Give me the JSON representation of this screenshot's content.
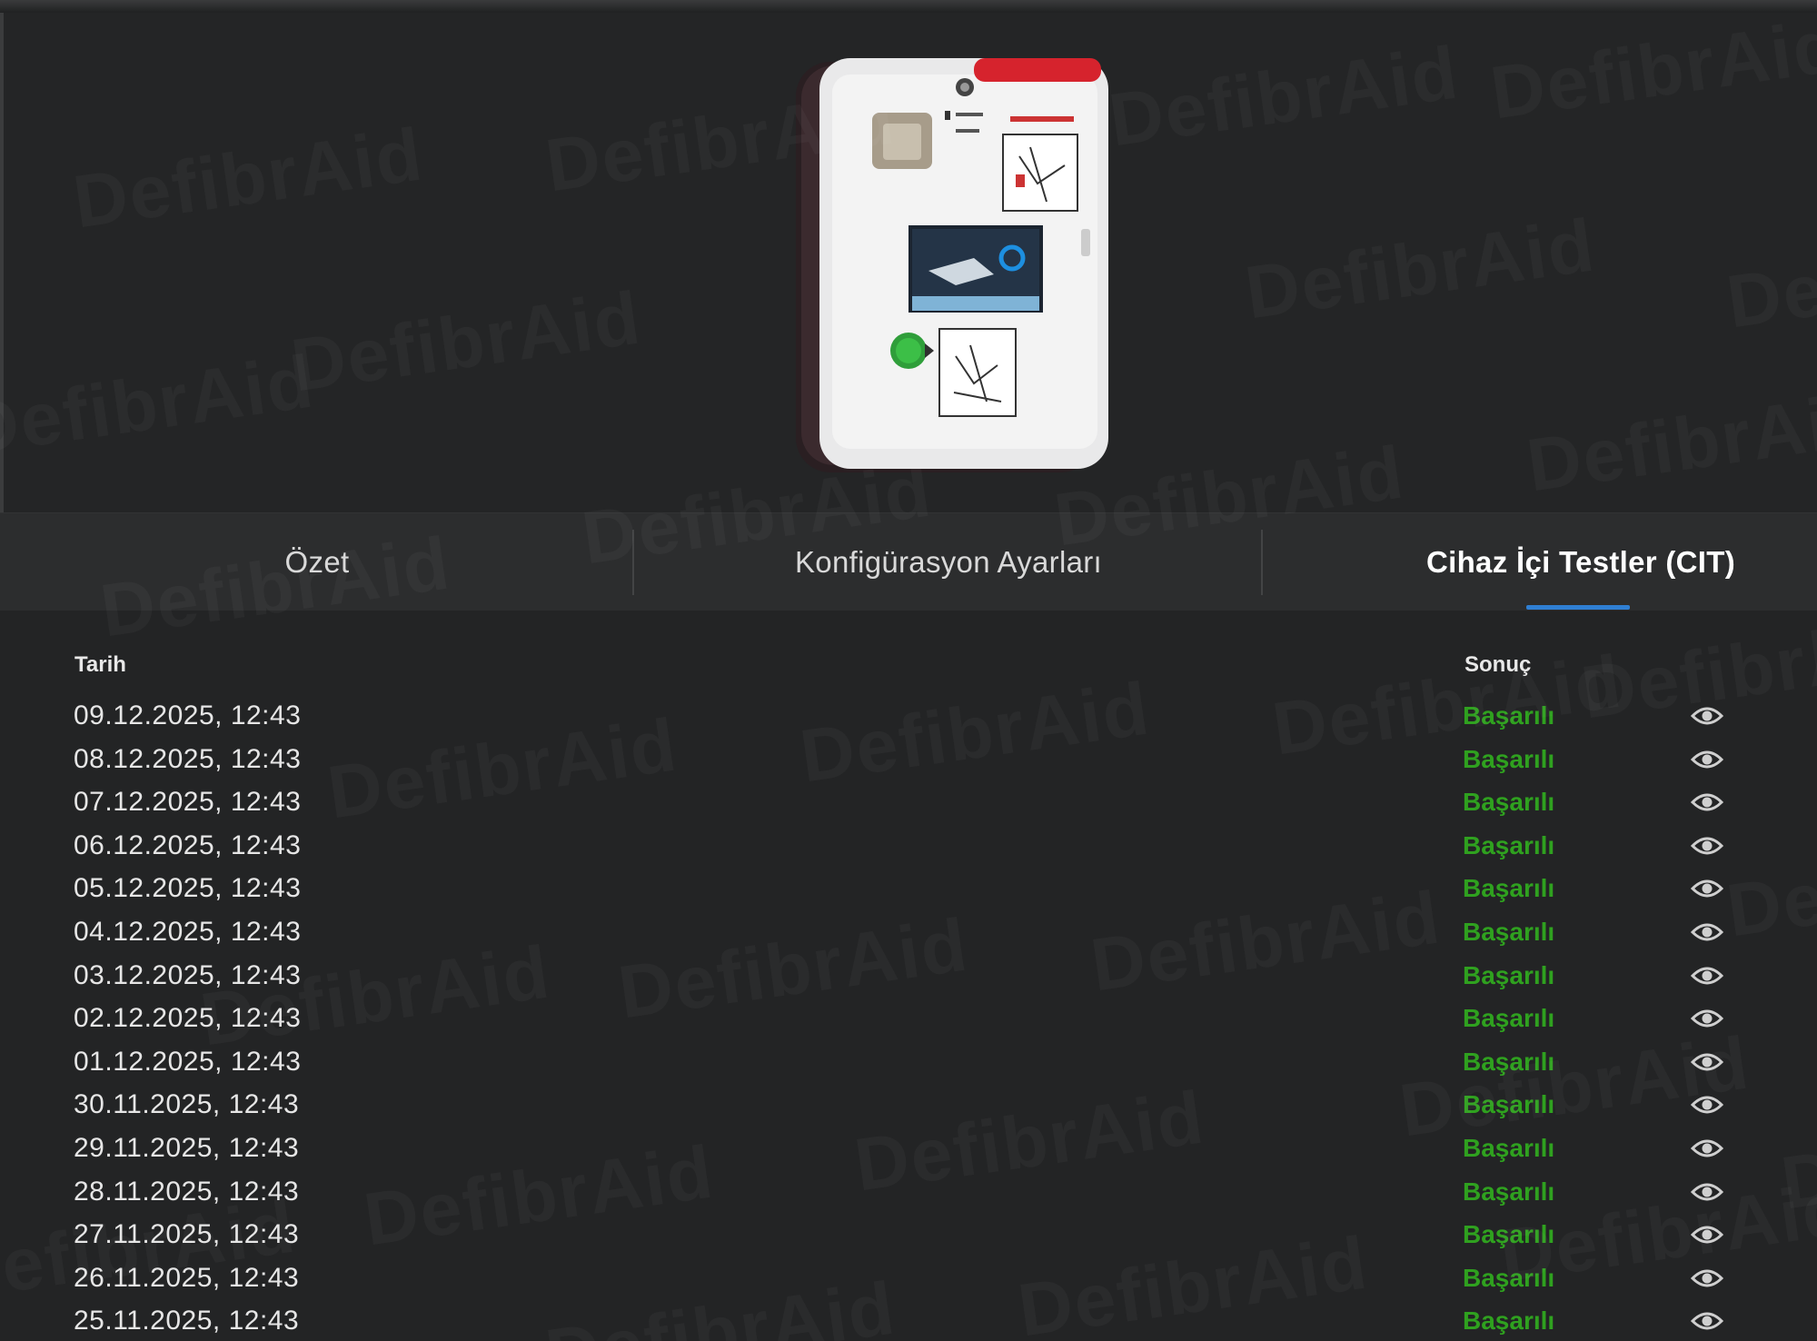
{
  "watermark": "DefibrAid",
  "tabs": [
    {
      "label": "Özet"
    },
    {
      "label": "Konfigürasyon Ayarları"
    },
    {
      "label": "Cihaz İçi Testler (CIT)"
    }
  ],
  "active_tab_index": 2,
  "table": {
    "headers": {
      "date": "Tarih",
      "result": "Sonuç"
    },
    "rows": [
      {
        "date": "09.12.2025, 12:43",
        "result": "Başarılı",
        "action_icon": "eye-icon"
      },
      {
        "date": "08.12.2025, 12:43",
        "result": "Başarılı",
        "action_icon": "eye-icon"
      },
      {
        "date": "07.12.2025, 12:43",
        "result": "Başarılı",
        "action_icon": "eye-icon"
      },
      {
        "date": "06.12.2025, 12:43",
        "result": "Başarılı",
        "action_icon": "eye-icon"
      },
      {
        "date": "05.12.2025, 12:43",
        "result": "Başarılı",
        "action_icon": "eye-icon"
      },
      {
        "date": "04.12.2025, 12:43",
        "result": "Başarılı",
        "action_icon": "eye-icon"
      },
      {
        "date": "03.12.2025, 12:43",
        "result": "Başarılı",
        "action_icon": "eye-icon"
      },
      {
        "date": "02.12.2025, 12:43",
        "result": "Başarılı",
        "action_icon": "eye-icon"
      },
      {
        "date": "01.12.2025, 12:43",
        "result": "Başarılı",
        "action_icon": "eye-icon"
      },
      {
        "date": "30.11.2025, 12:43",
        "result": "Başarılı",
        "action_icon": "eye-icon"
      },
      {
        "date": "29.11.2025, 12:43",
        "result": "Başarılı",
        "action_icon": "eye-icon"
      },
      {
        "date": "28.11.2025, 12:43",
        "result": "Başarılı",
        "action_icon": "eye-icon"
      },
      {
        "date": "27.11.2025, 12:43",
        "result": "Başarılı",
        "action_icon": "eye-icon"
      },
      {
        "date": "26.11.2025, 12:43",
        "result": "Başarılı",
        "action_icon": "eye-icon"
      },
      {
        "date": "25.11.2025, 12:43",
        "result": "Başarılı",
        "action_icon": "eye-icon"
      }
    ]
  },
  "colors": {
    "background": "#232425",
    "tab_bar": "#2c2d2e",
    "active_indicator": "#2f7fd3",
    "success": "#2fa11f"
  }
}
